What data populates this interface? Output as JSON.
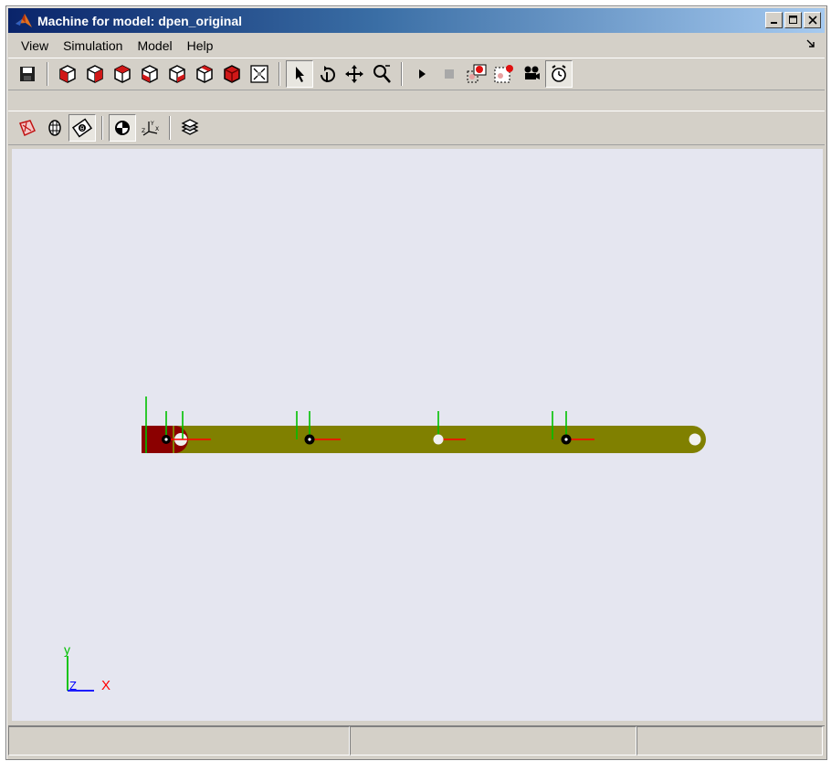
{
  "window": {
    "title": "Machine for model: dpen_original"
  },
  "menubar": {
    "items": [
      "View",
      "Simulation",
      "Model",
      "Help"
    ]
  },
  "toolbar1": {
    "icons": [
      "save-icon",
      "view-front-icon",
      "view-back-icon",
      "view-left-icon",
      "view-right-icon",
      "view-top-icon",
      "view-bottom-icon",
      "view-iso-icon",
      "fit-to-view-icon",
      "select-icon",
      "rotate-icon",
      "pan-icon",
      "zoom-icon",
      "play-icon",
      "stop-icon",
      "record-icon",
      "record-region-icon",
      "camera-icon",
      "timer-icon"
    ]
  },
  "toolbar2": {
    "icons": [
      "ellipsoid-icon",
      "convex-hull-icon",
      "cg-icon",
      "cg-marker-icon",
      "coordinate-frame-icon",
      "layers-icon"
    ]
  },
  "canvas": {
    "triad": {
      "x_label": "X",
      "y_label": "y",
      "z_label": "Z"
    }
  },
  "colors": {
    "canvas_bg": "#e5e6f0",
    "link": "#808000",
    "ground": "#8b0000",
    "axis_x": "#ff0000",
    "axis_y": "#00c000",
    "axis_z": "#0000ff"
  }
}
